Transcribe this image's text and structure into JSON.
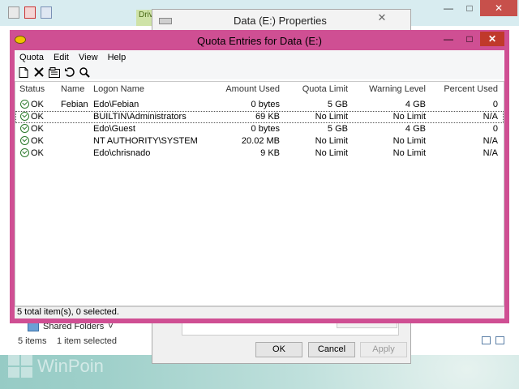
{
  "explorer": {
    "drive_tab": "Drive",
    "shared_folders": "Shared Folders",
    "item_count": "5 items",
    "selected_count": "1 item selected"
  },
  "properties": {
    "title": "Data (E:) Properties",
    "ok": "OK",
    "cancel": "Cancel",
    "apply": "Apply"
  },
  "quota": {
    "title": "Quota Entries for Data (E:)",
    "menu": [
      "Quota",
      "Edit",
      "View",
      "Help"
    ],
    "columns": [
      "Status",
      "Name",
      "Logon Name",
      "Amount Used",
      "Quota Limit",
      "Warning Level",
      "Percent Used"
    ],
    "rows": [
      {
        "status": "OK",
        "name": "Febian",
        "logon": "Edo\\Febian",
        "amount": "0 bytes",
        "limit": "5 GB",
        "warning": "4 GB",
        "percent": "0"
      },
      {
        "status": "OK",
        "name": "",
        "logon": "BUILTIN\\Administrators",
        "amount": "69 KB",
        "limit": "No Limit",
        "warning": "No Limit",
        "percent": "N/A"
      },
      {
        "status": "OK",
        "name": "",
        "logon": "Edo\\Guest",
        "amount": "0 bytes",
        "limit": "5 GB",
        "warning": "4 GB",
        "percent": "0"
      },
      {
        "status": "OK",
        "name": "",
        "logon": "NT AUTHORITY\\SYSTEM",
        "amount": "20.02 MB",
        "limit": "No Limit",
        "warning": "No Limit",
        "percent": "N/A"
      },
      {
        "status": "OK",
        "name": "",
        "logon": "Edo\\chrisnado",
        "amount": "9 KB",
        "limit": "No Limit",
        "warning": "No Limit",
        "percent": "N/A"
      }
    ],
    "status_text": "5 total item(s), 0 selected."
  },
  "watermark": "WinPoin",
  "colors": {
    "quota_frame": "#cf4f93",
    "close_red": "#c0392b",
    "ok_green": "#2b7a2b"
  }
}
